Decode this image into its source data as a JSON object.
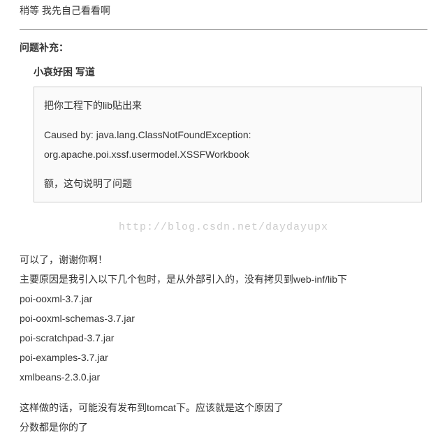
{
  "top_line": "稍等 我先自己看看啊",
  "section_title": "问题补充：",
  "quote_header": "小哀好困 写道",
  "quote": {
    "line1": "把你工程下的lib贴出来",
    "line2": "Caused by: java.lang.ClassNotFoundException:",
    "line3": "org.apache.poi.xssf.usermodel.XSSFWorkbook",
    "line4": "额，这句说明了问题"
  },
  "watermark": "http://blog.csdn.net/daydayupx",
  "reply": {
    "thanks": "可以了，谢谢你啊！",
    "reason": "主要原因是我引入以下几个包时，是从外部引入的，没有拷贝到web-inf/lib下",
    "jars": [
      "poi-ooxml-3.7.jar",
      "poi-ooxml-schemas-3.7.jar",
      "poi-scratchpad-3.7.jar",
      "poi-examples-3.7.jar",
      "xmlbeans-2.3.0.jar"
    ],
    "conclusion1": "这样做的话，可能没有发布到tomcat下。应该就是这个原因了",
    "conclusion2": "分数都是你的了"
  }
}
